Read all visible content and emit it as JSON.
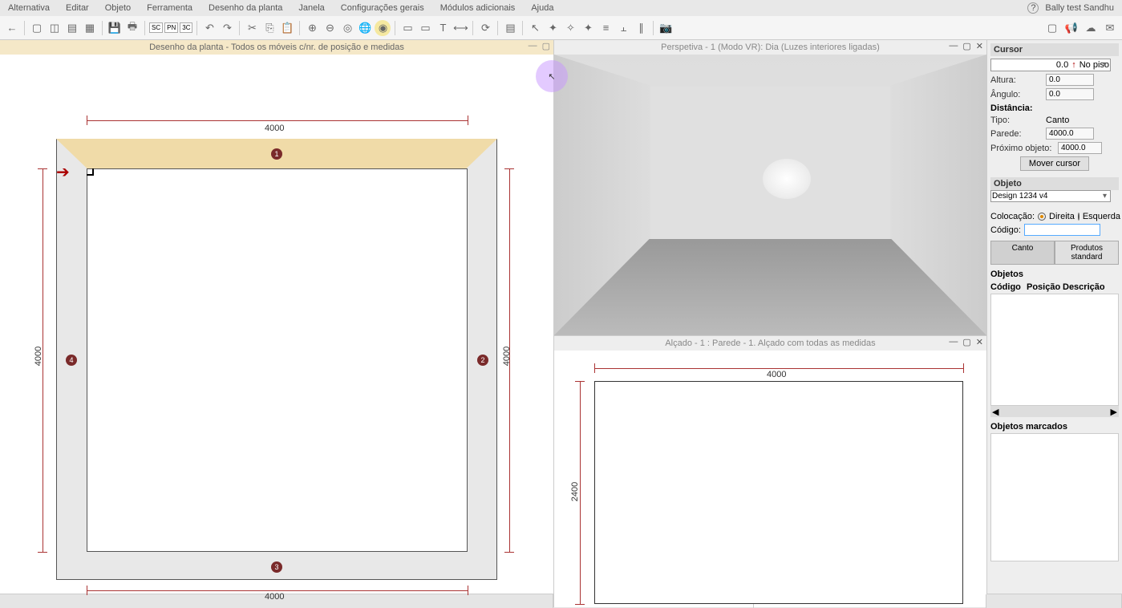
{
  "menu": {
    "alternativa": "Alternativa",
    "editar": "Editar",
    "objeto": "Objeto",
    "ferramenta": "Ferramenta",
    "desenho": "Desenho da planta",
    "janela": "Janela",
    "config": "Configurações gerais",
    "modulos": "Módulos adicionais",
    "ajuda": "Ajuda",
    "user": "Bally test  Sandhu"
  },
  "toolbar_text": {
    "sc": "SC",
    "pn": "PN",
    "d3": "3C"
  },
  "plan": {
    "title": "Desenho da planta - Todos os móveis c/nr. de posição e medidas",
    "dim_top": "4000",
    "dim_bottom": "4000",
    "dim_left": "4000",
    "dim_right": "4000",
    "w1": "1",
    "w2": "2",
    "w3": "3",
    "w4": "4"
  },
  "persp": {
    "title": "Perspetiva - 1 (Modo VR): Dia (Luzes interiores ligadas)"
  },
  "elev": {
    "title": "Alçado - 1 : Parede - 1. Alçado com todas as medidas",
    "dim_w": "4000",
    "dim_h": "2400"
  },
  "cursor_panel": {
    "header": "Cursor",
    "value": "0.0",
    "floor": "No piso",
    "altura_l": "Altura:",
    "altura_v": "0.0",
    "angulo_l": "Ângulo:",
    "angulo_v": "0.0",
    "dist_header": "Distância:",
    "tipo": "Tipo:",
    "canto": "Canto",
    "parede_l": "Parede:",
    "parede_v": "4000.0",
    "prox_l": "Próximo objeto:",
    "prox_v": "4000.0",
    "move_btn": "Mover cursor"
  },
  "objeto_panel": {
    "header": "Objeto",
    "select": "Design 1234 v4",
    "coloc": "Colocação:",
    "direita": "Direita",
    "esquerda": "Esquerda",
    "codigo": "Código:",
    "tab_canto": "Canto",
    "tab_prod": "Produtos standard"
  },
  "objetos_list": {
    "header": "Objetos",
    "col_codigo": "Código",
    "col_pos": "Posição",
    "col_desc": "Descrição"
  },
  "marcados": {
    "header": "Objetos marcados"
  }
}
